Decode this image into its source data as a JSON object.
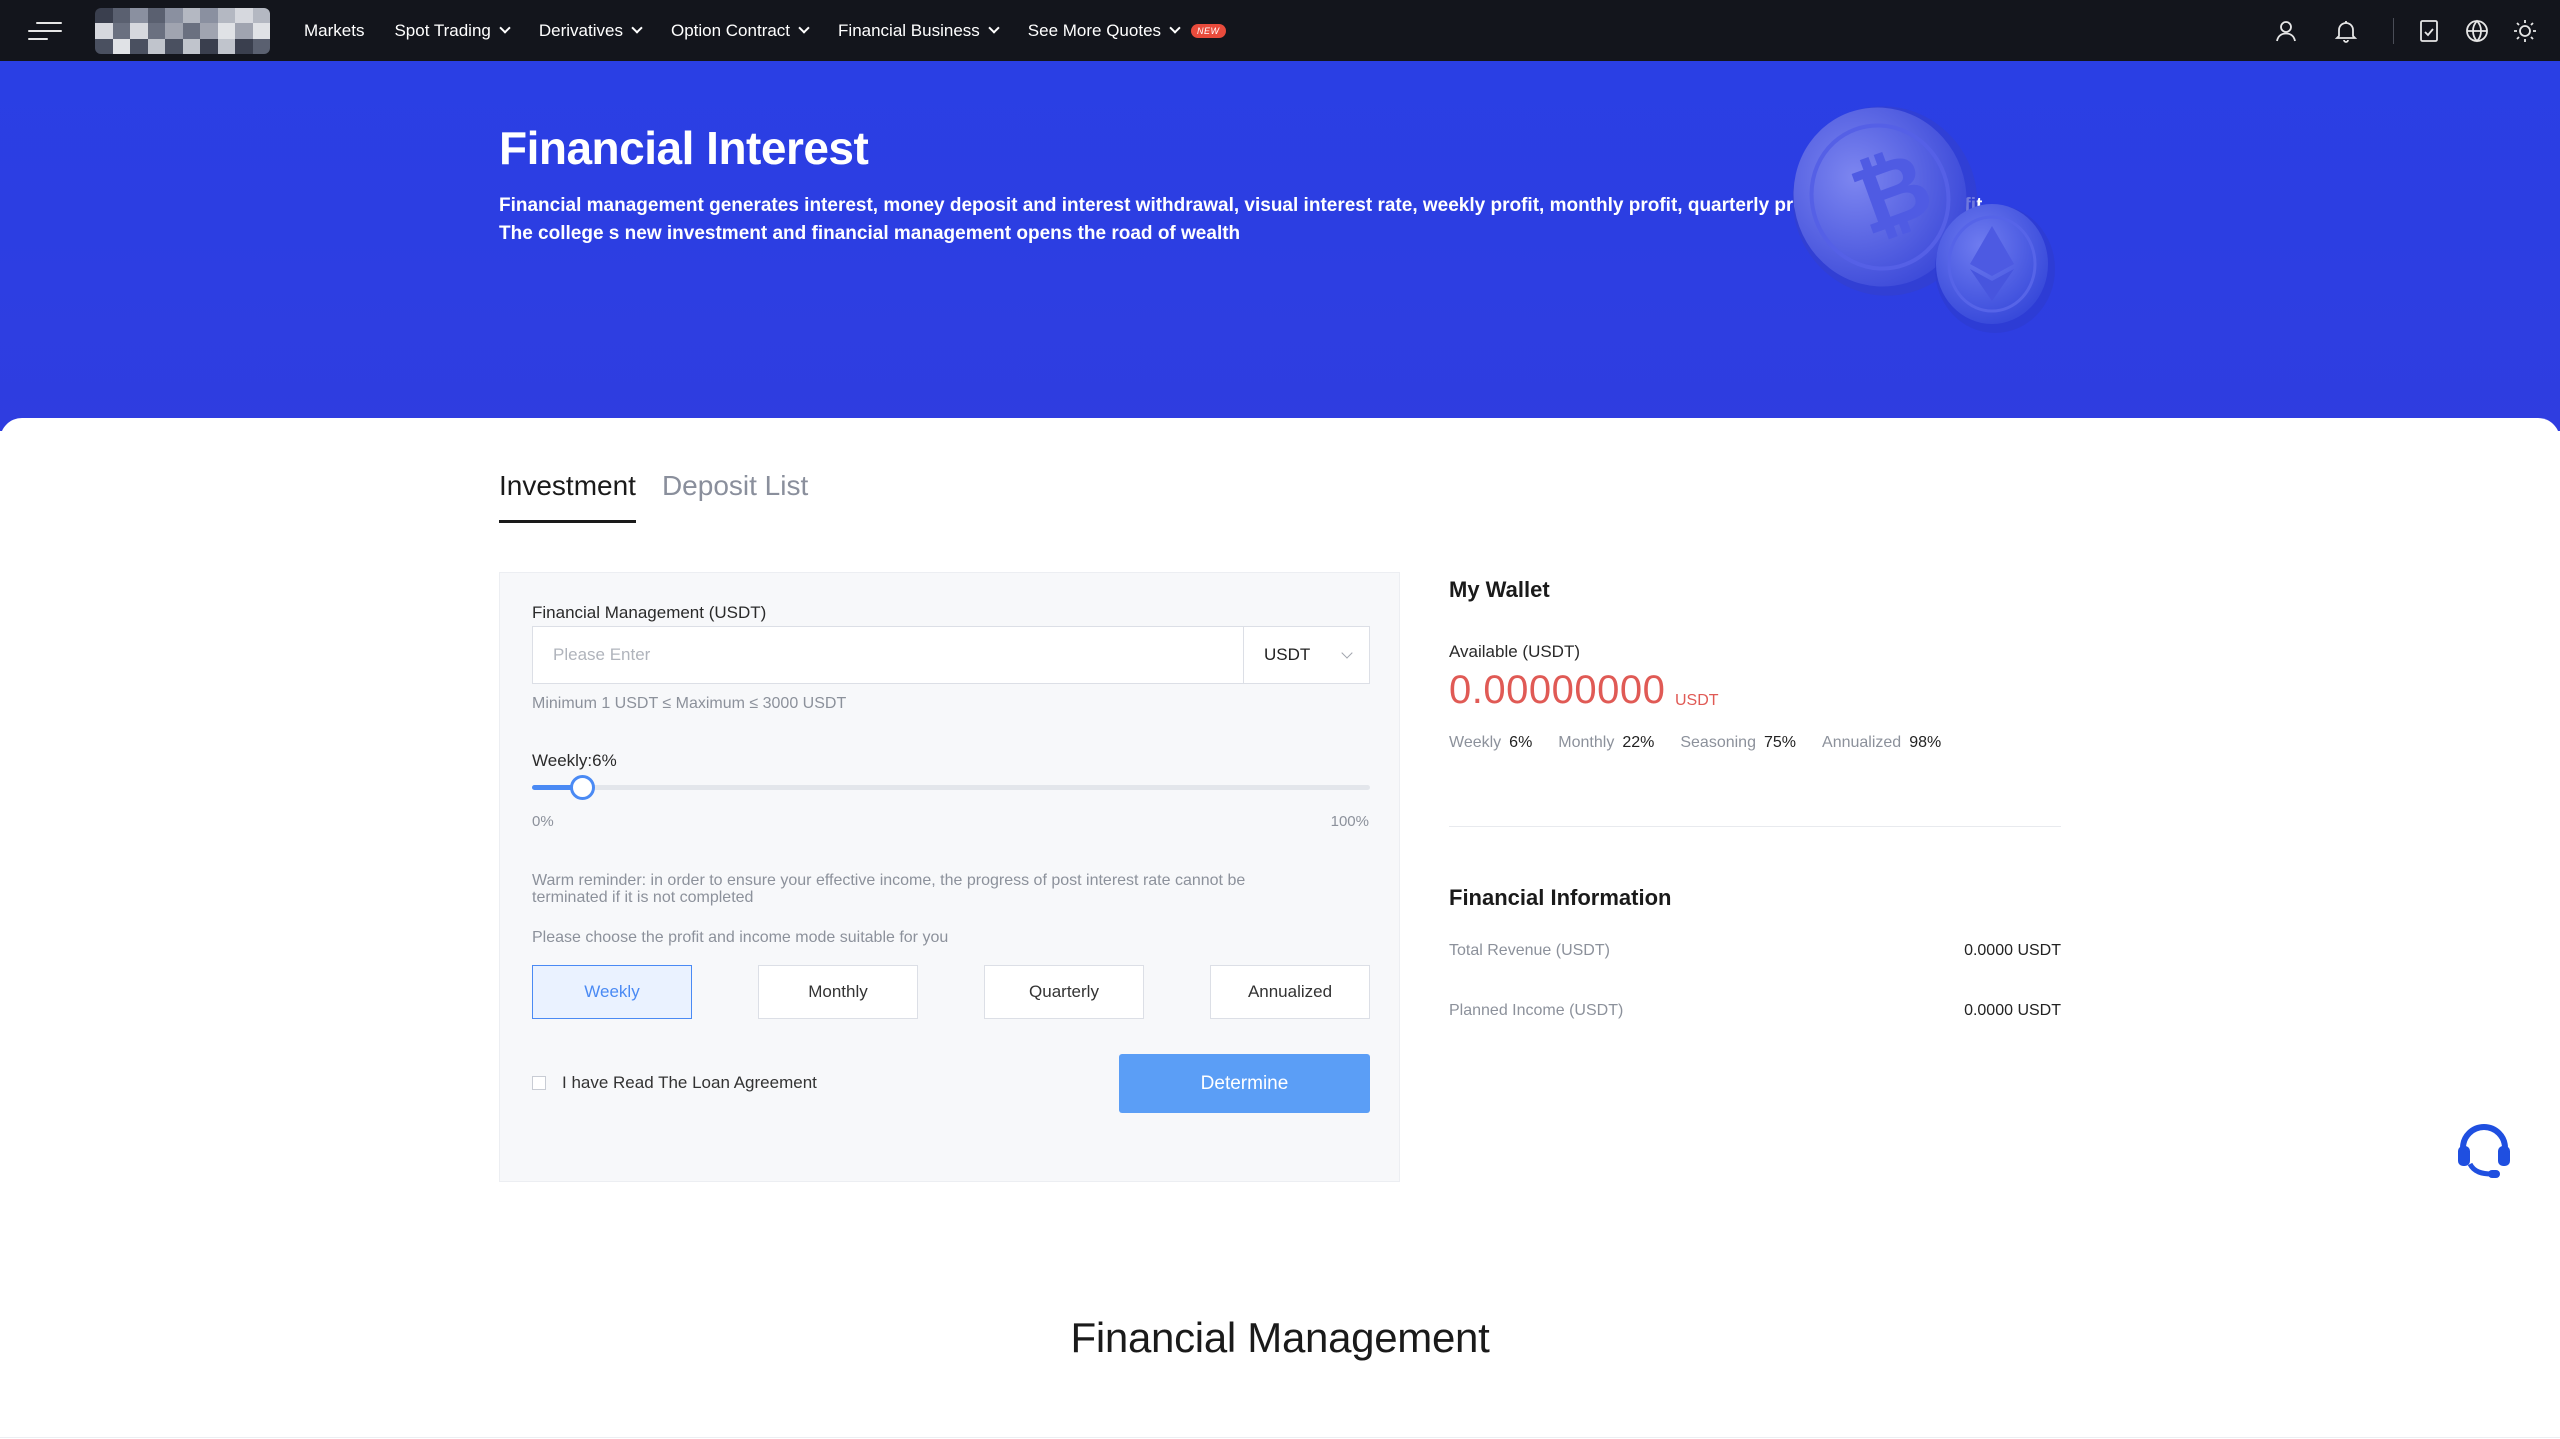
{
  "nav": {
    "items": [
      {
        "label": "Markets",
        "has_dropdown": false
      },
      {
        "label": "Spot Trading",
        "has_dropdown": true
      },
      {
        "label": "Derivatives",
        "has_dropdown": true
      },
      {
        "label": "Option Contract",
        "has_dropdown": true
      },
      {
        "label": "Financial Business",
        "has_dropdown": true
      },
      {
        "label": "See More Quotes",
        "has_dropdown": true
      }
    ],
    "new_badge": "NEW",
    "right_icons": [
      "user-icon",
      "bell-icon",
      "document-icon",
      "globe-icon",
      "sun-icon"
    ]
  },
  "hero": {
    "title": "Financial Interest",
    "description_line1": "Financial management generates interest, money deposit and interest withdrawal, visual interest rate, weekly profit, monthly profit, quarterly profit and annual profit.",
    "description_line2": "The college s new investment and financial management opens the road of wealth"
  },
  "tabs": [
    {
      "label": "Investment",
      "active": true
    },
    {
      "label": "Deposit List",
      "active": false
    }
  ],
  "form": {
    "amount_label": "Financial Management (USDT)",
    "amount_placeholder": "Please Enter",
    "currency": "USDT",
    "limits_hint": "Minimum 1 USDT ≤ Maximum ≤ 3000 USDT",
    "rate_label": "Weekly:6%",
    "slider_value_pct": 6,
    "slider_min_label": "0%",
    "slider_max_label": "100%",
    "reminder_line1": "Warm reminder: in order to ensure your effective income, the progress of post interest rate cannot be",
    "reminder_line2": "terminated if it is not completed",
    "mode_prompt": "Please choose the profit and income mode suitable for you",
    "modes": [
      {
        "label": "Weekly",
        "active": true
      },
      {
        "label": "Monthly",
        "active": false
      },
      {
        "label": "Quarterly",
        "active": false
      },
      {
        "label": "Annualized",
        "active": false
      }
    ],
    "agreement_label": "I have Read The Loan Agreement",
    "agreement_checked": false,
    "submit_label": "Determine"
  },
  "wallet": {
    "title": "My Wallet",
    "available_label": "Available (USDT)",
    "balance": "0.00000000",
    "balance_unit": "USDT",
    "rates": [
      {
        "label": "Weekly",
        "value": "6%"
      },
      {
        "label": "Monthly",
        "value": "22%"
      },
      {
        "label": "Seasoning",
        "value": "75%"
      },
      {
        "label": "Annualized",
        "value": "98%"
      }
    ]
  },
  "financial_info": {
    "title": "Financial Information",
    "rows": [
      {
        "label": "Total Revenue (USDT)",
        "value": "0.0000 USDT"
      },
      {
        "label": "Planned Income (USDT)",
        "value": "0.0000 USDT"
      }
    ]
  },
  "section": {
    "title": "Financial Management"
  },
  "colors": {
    "nav_bg": "#13151c",
    "hero_bg": "#2f3de0",
    "accent_blue": "#4a8af4",
    "button_blue": "#5b9ef6",
    "balance_red": "#e05a55",
    "badge_red": "#e84b3c",
    "support_blue": "#1f4fe0"
  }
}
